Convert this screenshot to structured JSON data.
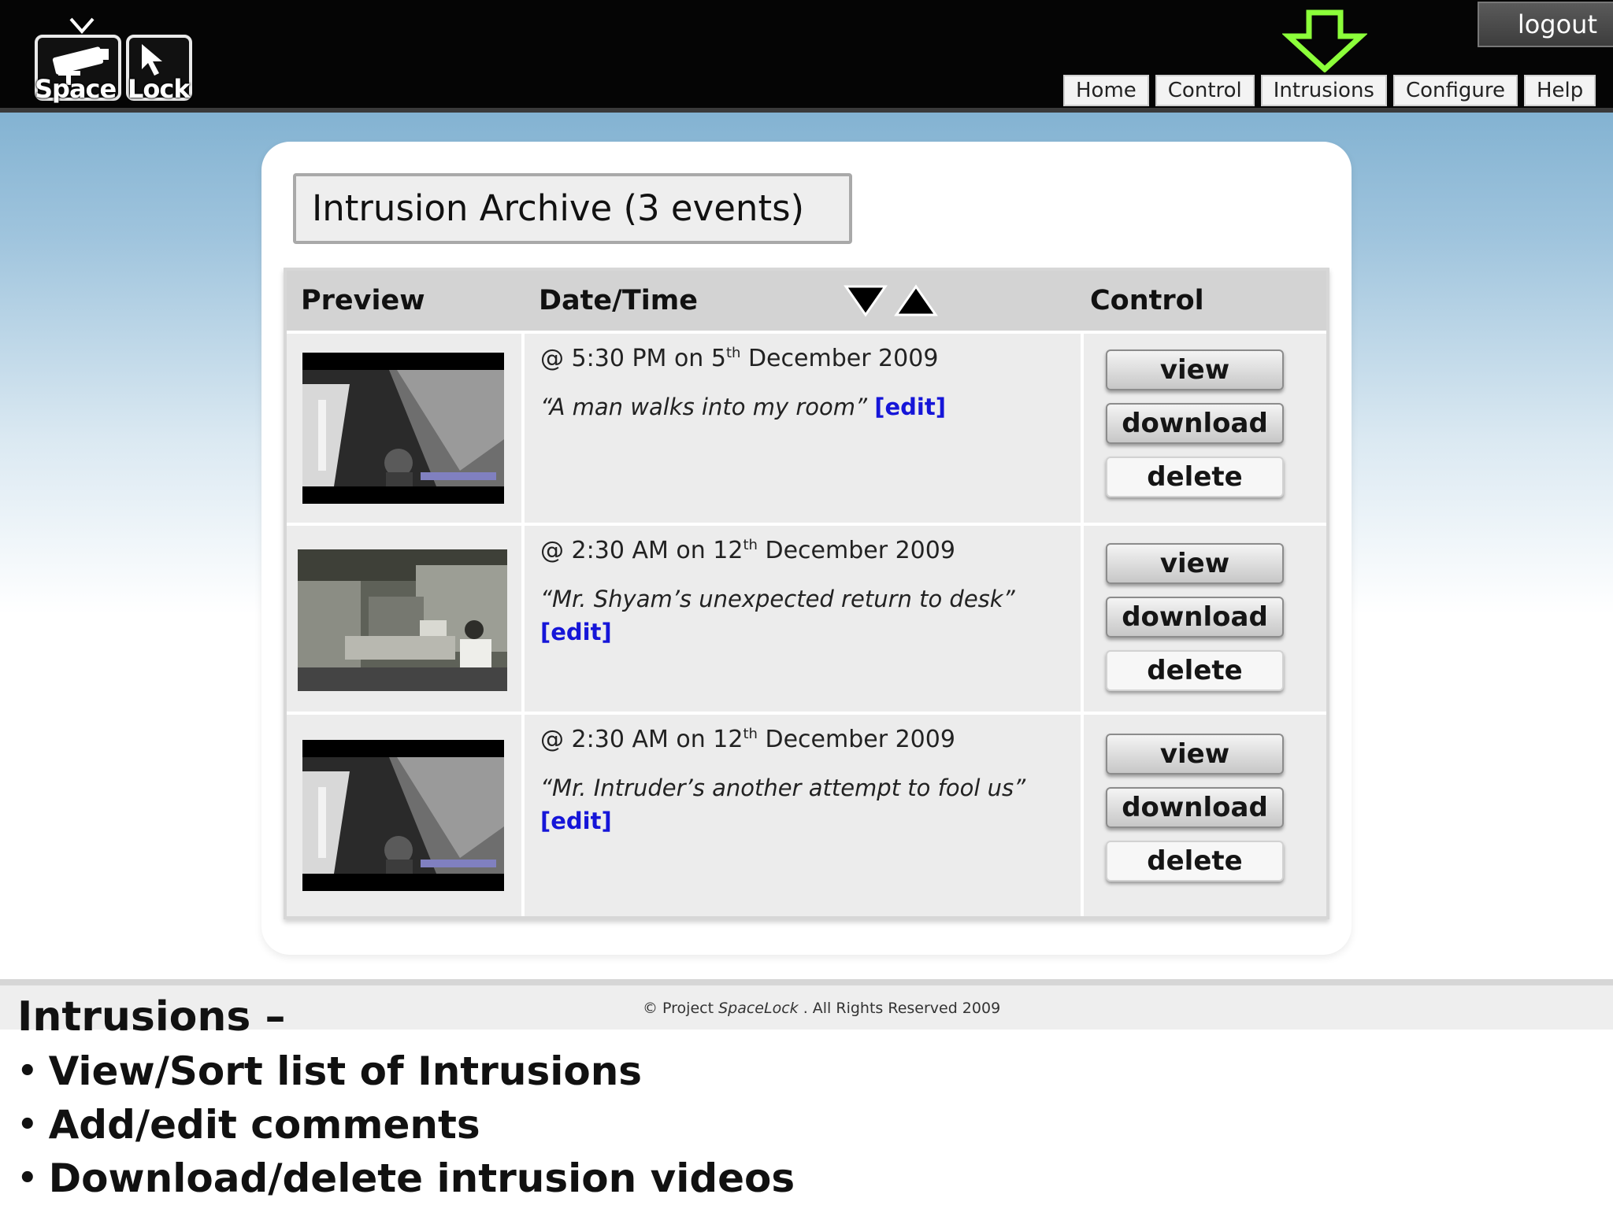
{
  "header": {
    "logo": {
      "word_left": "Space",
      "word_right": "Lock"
    },
    "logout_label": "logout",
    "nav": [
      {
        "label": "Home"
      },
      {
        "label": "Control"
      },
      {
        "label": "Intrusions"
      },
      {
        "label": "Configure"
      },
      {
        "label": "Help"
      }
    ],
    "active_tab": "Intrusions",
    "active_indicator_color": "#8cff3a"
  },
  "archive": {
    "title": "Intrusion Archive (3 events)",
    "columns": {
      "preview": "Preview",
      "datetime": "Date/Time",
      "control": "Control"
    },
    "sort_icons": [
      "sort-descending-icon",
      "sort-ascending-icon"
    ],
    "events": [
      {
        "time_prefix": "@ 5:30 PM on 5",
        "ordinal": "th",
        "time_suffix": " December 2009",
        "comment": "“A man walks into my room”",
        "edit_label": "[edit]",
        "preview": "outdoor-camera-frame",
        "buttons": {
          "view": "view",
          "download": "download",
          "delete": "delete"
        }
      },
      {
        "time_prefix": "@ 2:30 AM on 12",
        "ordinal": "th",
        "time_suffix": " December 2009",
        "comment": "“Mr. Shyam’s unexpected return to desk”",
        "edit_label": "[edit]",
        "preview": "office-cubicle-frame",
        "buttons": {
          "view": "view",
          "download": "download",
          "delete": "delete"
        }
      },
      {
        "time_prefix": "@ 2:30 AM on 12",
        "ordinal": "th",
        "time_suffix": " December 2009",
        "comment": "“Mr. Intruder’s another attempt to fool us”",
        "edit_label": "[edit]",
        "preview": "outdoor-camera-frame",
        "buttons": {
          "view": "view",
          "download": "download",
          "delete": "delete"
        }
      }
    ]
  },
  "footer": {
    "copyright_prefix": "© Project ",
    "copyright_brand": "SpaceLock",
    "copyright_suffix": " . All Rights Reserved 2009"
  },
  "notes": {
    "title": "Intrusions –",
    "bullet": "•",
    "items": [
      "View/Sort list of Intrusions",
      "Add/edit comments",
      "Download/delete intrusion videos"
    ]
  }
}
